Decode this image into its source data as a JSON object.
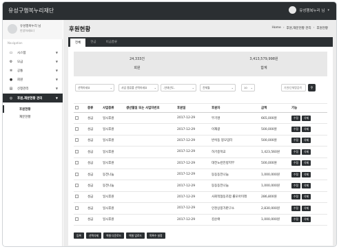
{
  "app": {
    "brand": "유성구행복누리재단",
    "user": "유성행복누리 님"
  },
  "sidebar": {
    "profile": {
      "name": "유성행복누리 님",
      "role": "안녕하세요:)"
    },
    "nav_label": "Navigation",
    "items": [
      {
        "label": "시스템",
        "icon": "monitor-icon"
      },
      {
        "label": "모금",
        "icon": "gears-icon"
      },
      {
        "label": "공통",
        "icon": "gear-icon"
      },
      {
        "label": "회원",
        "icon": "user-icon"
      },
      {
        "label": "신청관리",
        "icon": "document-icon"
      },
      {
        "label": "후원,재분현황 관리",
        "icon": "globe-icon"
      }
    ],
    "subitems": [
      {
        "label": "후원현황"
      },
      {
        "label": "재분현황"
      }
    ]
  },
  "page": {
    "title": "후원현황",
    "breadcrumb": [
      "Home",
      "후원,재분현황 관리",
      "후원현황"
    ]
  },
  "tabs": [
    "전체",
    "현금",
    "비금품류"
  ],
  "summary": {
    "count_value": "24,333건",
    "count_label": "회원",
    "amount_value": "3,413,579,998원",
    "amount_label": "합계"
  },
  "filters": {
    "select1": "선택하세요",
    "select2": "사업 종류를 선택하세요",
    "select3": "-연대년도-",
    "select4": "전체월",
    "page_size": "10",
    "search_placeholder": "기관/단체명검색"
  },
  "table": {
    "columns": [
      "",
      "종류",
      "사업종류",
      "생년월일 또는 사업자번호",
      "후원일",
      "후원자",
      "금액",
      "기능"
    ],
    "rows": [
      {
        "kind": "성금",
        "type": "일시후원",
        "id": "",
        "date": "2017-12-29",
        "donor": "무기명",
        "amount": "665,000원"
      },
      {
        "kind": "성금",
        "type": "일시후원",
        "id": "",
        "date": "2017-12-29",
        "donor": "이재광",
        "amount": "500,000원"
      },
      {
        "kind": "성금",
        "type": "일시후원",
        "id": "",
        "date": "2017-12-29",
        "donor": "반석동 봉모임터",
        "amount": "500,000원"
      },
      {
        "kind": "성금",
        "type": "일시후원",
        "id": "",
        "date": "2017-12-29",
        "donor": "하기중학교",
        "amount": "1,423,560원"
      },
      {
        "kind": "성금",
        "type": "일시후원",
        "id": "",
        "date": "2017-12-29",
        "donor": "대전노련진량지부",
        "amount": "500,000원"
      },
      {
        "kind": "성금",
        "type": "동전나눔",
        "id": "",
        "date": "2017-12-29",
        "donor": "동동동전나눔",
        "amount": "1,000,000원"
      },
      {
        "kind": "성금",
        "type": "동전나눔",
        "id": "",
        "date": "2017-12-29",
        "donor": "동동동전나눔",
        "amount": "1,000,000원"
      },
      {
        "kind": "성금",
        "type": "일시후원",
        "id": "",
        "date": "2017-12-29",
        "donor": "사회적협동조합 롤모아미래",
        "amount": "286,800원"
      },
      {
        "kind": "성금",
        "type": "일시후원",
        "id": "",
        "date": "2017-12-29",
        "donor": "인천상봉가판구소",
        "amount": "2,830,000원"
      },
      {
        "kind": "성금",
        "type": "일시후원",
        "id": "",
        "date": "2017-12-29",
        "donor": "김순애",
        "amount": "1,000,000원"
      }
    ],
    "action_edit": "수정",
    "action_delete": "삭제"
  },
  "bottom_buttons": [
    "등록",
    "선택삭제",
    "엑셀 다운로드",
    "엑셀 업로드",
    "목록수 설정"
  ]
}
